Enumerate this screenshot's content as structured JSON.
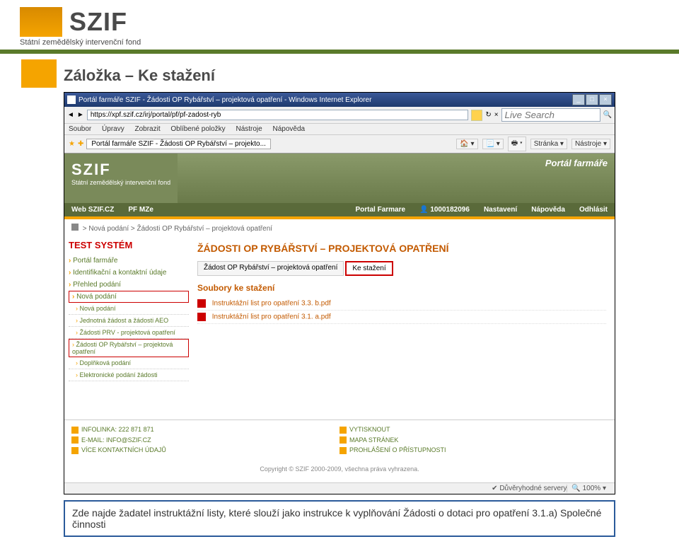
{
  "slide": {
    "org_logo": "SZIF",
    "org_subtitle": "Státní zemědělský intervenční fond",
    "title": "Záložka – Ke stažení",
    "callout_text": "Zde najde žadatel instruktážní listy, které slouží jako instrukce k vyplňování Žádosti o dotaci pro opatření 3.1.a) Společné činnosti"
  },
  "ie": {
    "window_title": "Portál farmáře SZIF - Žádosti OP Rybářství – projektová opatření - Windows Internet Explorer",
    "url": "https://xpf.szif.cz/irj/portal/pf/pf-zadost-ryb",
    "search_placeholder": "Live Search",
    "menu": {
      "soubor": "Soubor",
      "upravy": "Úpravy",
      "zobrazit": "Zobrazit",
      "oblibene": "Oblíbené položky",
      "nastroje": "Nástroje",
      "napoveda": "Nápověda"
    },
    "fav_label": "Portál farmáře SZIF - Žádosti OP Rybářství – projekto...",
    "tool": {
      "stranka": "Stránka ▾",
      "nastroje": "Nástroje ▾"
    },
    "status": {
      "trusted": "Důvěryhodné servery",
      "zoom": "100%"
    }
  },
  "portal": {
    "logo": "SZIF",
    "logo_sub": "Státní zemědělský intervenční fond",
    "banner_label": "Portál farmáře",
    "tabs": {
      "web": "Web SZIF.CZ",
      "mze": "PF MZe",
      "pf": "Portal Farmare",
      "user": "1000182096",
      "nast": "Nastavení",
      "nap": "Nápověda",
      "odh": "Odhlásit"
    },
    "breadcrumb": "> Nová podání > Žádosti OP Rybářství – projektová opatření",
    "sidebar": {
      "test": "TEST SYSTÉM",
      "items": [
        "Portál farmáře",
        "Identifikační a kontaktní údaje",
        "Přehled podání",
        "Nová podání"
      ],
      "subs": [
        "Nová podání",
        "Jednotná žádost a žádosti AEO",
        "Žádosti PRV - projektová opatření",
        "Žádosti OP Rybářství – projektová opatření",
        "Doplňková podání",
        "Elektronické podání žádosti"
      ]
    },
    "main": {
      "h1": "ŽÁDOSTI OP RYBÁŘSTVÍ – PROJEKTOVÁ OPATŘENÍ",
      "tab1": "Žádost OP Rybářství – projektová opatření",
      "tab2": "Ke stažení",
      "section": "Soubory ke stažení",
      "files": [
        "Instruktážní list pro opatření 3.3. b.pdf",
        "Instruktážní list pro opatření 3.1. a.pdf"
      ]
    },
    "footer": {
      "infolinka_label": "INFOLINKA:",
      "infolinka_val": "222 871 871",
      "email_label": "E-MAIL:",
      "email_val": "INFO@SZIF.CZ",
      "kontakt": "VÍCE KONTAKTNÍCH ÚDAJŮ",
      "tisk": "VYTISKNOUT",
      "mapa": "MAPA STRÁNEK",
      "prohl": "PROHLÁŠENÍ O PŘÍSTUPNOSTI",
      "copyright": "Copyright © SZIF 2000-2009, všechna práva vyhrazena."
    }
  }
}
